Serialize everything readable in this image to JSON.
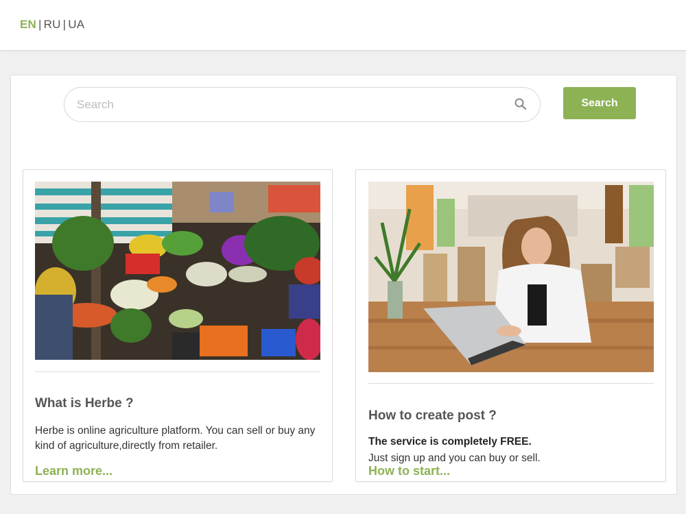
{
  "languages": {
    "items": [
      "EN",
      "RU",
      "UA"
    ],
    "active": "EN"
  },
  "search": {
    "placeholder": "Search",
    "value": "",
    "button_label": "Search"
  },
  "cards": [
    {
      "title": "What is Herbe ?",
      "text": "Herbe is online agriculture platform. You can sell or buy any kind of agriculture,directly from retailer.",
      "link": "Learn more..."
    },
    {
      "title": "How to create post ?",
      "strong": "The service is completely FREE.",
      "text": "Just sign up and you can buy or sell.",
      "link": "How to start..."
    }
  ],
  "colors": {
    "accent": "#8db254",
    "background": "#f0f0f0"
  },
  "icons": {
    "search": "search-icon"
  }
}
